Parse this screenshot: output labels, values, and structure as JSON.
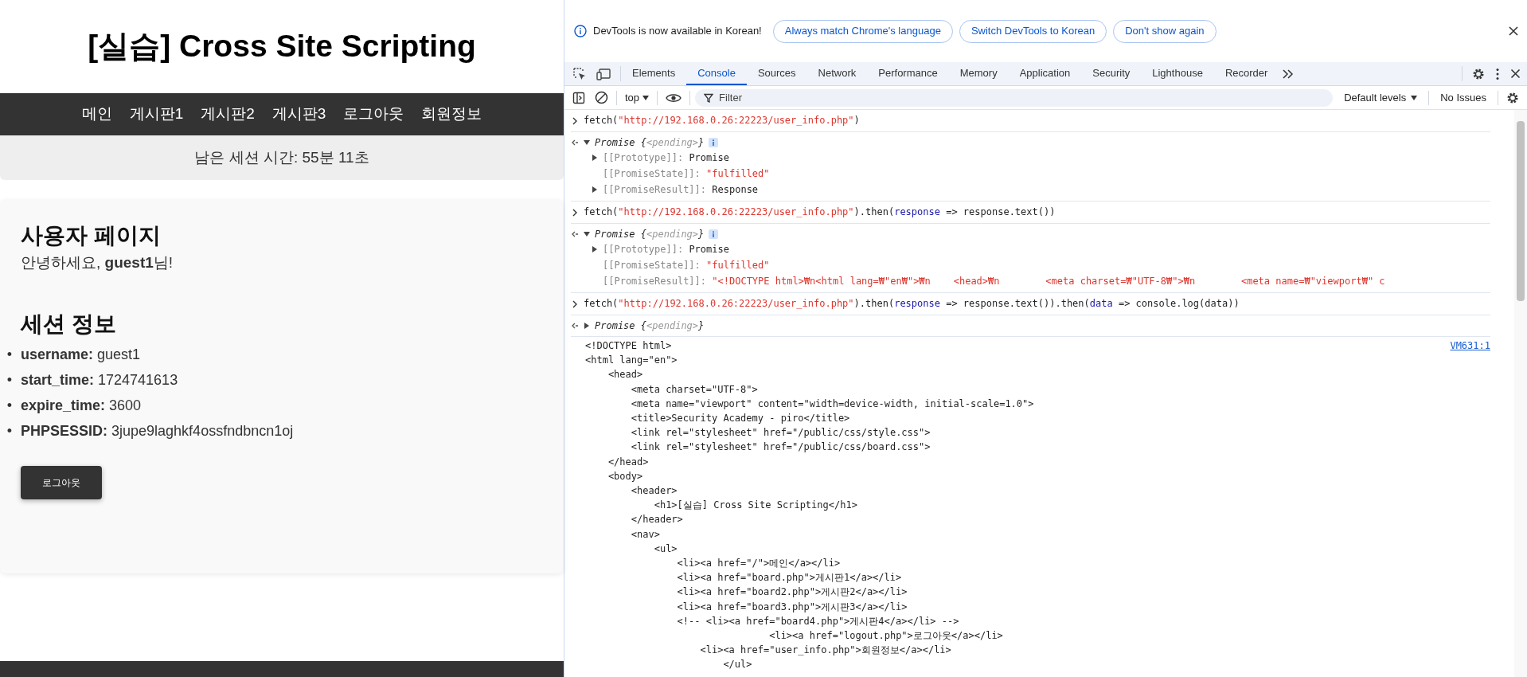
{
  "page": {
    "title": "[실습] Cross Site Scripting",
    "nav": [
      {
        "label": "메인"
      },
      {
        "label": "게시판1"
      },
      {
        "label": "게시판2"
      },
      {
        "label": "게시판3"
      },
      {
        "label": "로그아웃"
      },
      {
        "label": "회원정보"
      }
    ],
    "session_timer": "남은 세션 시간: 55분 11초",
    "user_card": {
      "heading": "사용자 페이지",
      "greeting": "안녕하세요, **guest1**님!",
      "session_heading": "세션 정보",
      "session_items": [
        {
          "marker": "•",
          "key": "username:",
          "value": "guest1"
        },
        {
          "marker": "•",
          "key": "start_time:",
          "value": "1724741613"
        },
        {
          "marker": "•",
          "key": "expire_time:",
          "value": "3600"
        },
        {
          "marker": "•",
          "key": "PHPSESSID:",
          "value": "3jupe9laghkf4ossfndbncn1oj"
        }
      ],
      "logout_button": "로그아웃"
    }
  },
  "devtools": {
    "infobar": {
      "message": "DevTools is now available in Korean!",
      "buttons": [
        "Always match Chrome's language",
        "Switch DevTools to Korean",
        "Don't show again"
      ]
    },
    "tabs": [
      {
        "label": "Elements",
        "selected": false
      },
      {
        "label": "Console",
        "selected": true
      },
      {
        "label": "Sources",
        "selected": false
      },
      {
        "label": "Network",
        "selected": false
      },
      {
        "label": "Performance",
        "selected": false
      },
      {
        "label": "Memory",
        "selected": false
      },
      {
        "label": "Application",
        "selected": false
      },
      {
        "label": "Security",
        "selected": false
      },
      {
        "label": "Lighthouse",
        "selected": false
      },
      {
        "label": "Recorder",
        "selected": false
      }
    ],
    "toolbar": {
      "context": "top",
      "filter_placeholder": "Filter",
      "levels": "Default levels",
      "issues": "No Issues"
    },
    "console": [
      {
        "kind": "input",
        "tokens": [
          {
            "text": "fetch(",
            "kind": "plain"
          },
          {
            "text": "\"http://192.168.0.26:22223/user_info.php\"",
            "kind": "string"
          },
          {
            "text": ")",
            "kind": "plain"
          }
        ]
      },
      {
        "kind": "result",
        "expanded": true,
        "tokens": [
          {
            "text": "Promise {",
            "kind": "plain"
          },
          {
            "text": "<pending>",
            "kind": "muted"
          },
          {
            "text": "}",
            "kind": "plain"
          }
        ],
        "properties": [
          {
            "name": "[[Prototype]]:",
            "value": "Promise",
            "expandable": true,
            "kind": "plain"
          },
          {
            "name": "[[PromiseState]]:",
            "value": "\"fulfilled\"",
            "expandable": false,
            "kind": "string"
          },
          {
            "name": "[[PromiseResult]]:",
            "value": "Response",
            "expandable": true,
            "kind": "plain"
          }
        ]
      },
      {
        "kind": "input",
        "tokens": [
          {
            "text": "fetch(",
            "kind": "plain"
          },
          {
            "text": "\"http://192.168.0.26:22223/user_info.php\"",
            "kind": "string"
          },
          {
            "text": ").then(",
            "kind": "plain"
          },
          {
            "text": "response",
            "kind": "param"
          },
          {
            "text": " => response.text())",
            "kind": "plain"
          }
        ]
      },
      {
        "kind": "result",
        "expanded": true,
        "tokens": [
          {
            "text": "Promise {",
            "kind": "plain"
          },
          {
            "text": "<pending>",
            "kind": "muted"
          },
          {
            "text": "}",
            "kind": "plain"
          }
        ],
        "properties": [
          {
            "name": "[[Prototype]]:",
            "value": "Promise",
            "expandable": true,
            "kind": "plain"
          },
          {
            "name": "[[PromiseState]]:",
            "value": "\"fulfilled\"",
            "expandable": false,
            "kind": "string"
          },
          {
            "name": "[[PromiseResult]]:",
            "value": "\"<!DOCTYPE html>₩n<html lang=₩\"en₩\">₩n    <head>₩n        <meta charset=₩\"UTF-8₩\">₩n        <meta name=₩\"viewport₩\" c",
            "expandable": false,
            "kind": "string"
          }
        ]
      },
      {
        "kind": "input",
        "tokens": [
          {
            "text": "fetch(",
            "kind": "plain"
          },
          {
            "text": "\"http://192.168.0.26:22223/user_info.php\"",
            "kind": "string"
          },
          {
            "text": ").then(",
            "kind": "plain"
          },
          {
            "text": "response",
            "kind": "param"
          },
          {
            "text": " => response.text()).then(",
            "kind": "plain"
          },
          {
            "text": "data",
            "kind": "param"
          },
          {
            "text": " => console.log(data))",
            "kind": "plain"
          }
        ]
      },
      {
        "kind": "result",
        "expanded": false,
        "tokens": [
          {
            "text": "Promise {",
            "kind": "plain"
          },
          {
            "text": "<pending>",
            "kind": "muted"
          },
          {
            "text": "}",
            "kind": "plain"
          }
        ]
      },
      {
        "kind": "log",
        "source": "VM631:1",
        "lines": [
          "<!DOCTYPE html>",
          "<html lang=\"en\">",
          "    <head>",
          "        <meta charset=\"UTF-8\">",
          "        <meta name=\"viewport\" content=\"width=device-width, initial-scale=1.0\">",
          "        <title>Security Academy - piro</title>",
          "        <link rel=\"stylesheet\" href=\"/public/css/style.css\">",
          "        <link rel=\"stylesheet\" href=\"/public/css/board.css\">",
          "    </head>",
          "    <body>",
          "        <header>",
          "            <h1>[실습] Cross Site Scripting</h1>",
          "        </header>",
          "        <nav>",
          "            <ul>",
          "                <li><a href=\"/\">메인</a></li>",
          "                <li><a href=\"board.php\">게시판1</a></li>",
          "                <li><a href=\"board2.php\">게시판2</a></li>",
          "                <li><a href=\"board3.php\">게시판3</a></li>",
          "                <!-- <li><a href=\"board4.php\">게시판4</a></li> -->",
          "                                <li><a href=\"logout.php\">로그아웃</a></li>",
          "                    <li><a href=\"user_info.php\">회원정보</a></li>",
          "                        </ul>"
        ]
      }
    ]
  }
}
